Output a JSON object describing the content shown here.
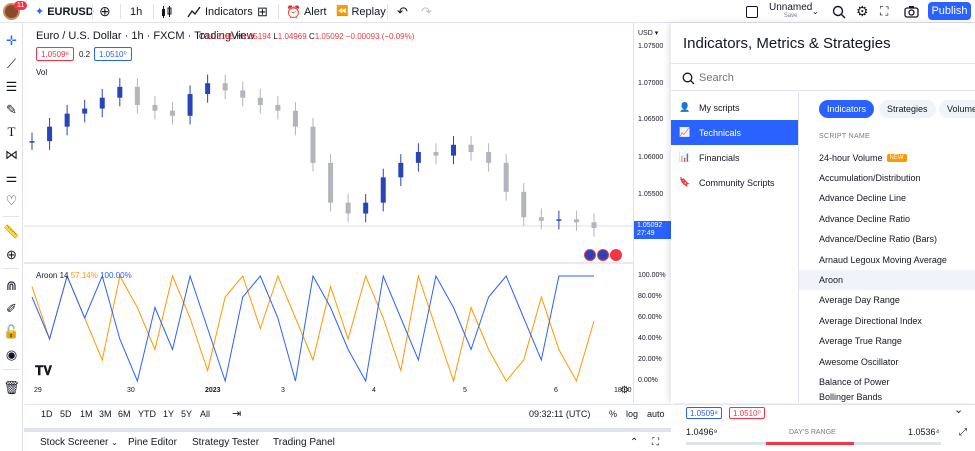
{
  "topbar": {
    "badge": "11",
    "symbol": "EURUSD",
    "interval": "1h",
    "indicators_label": "Indicators",
    "alert_label": "Alert",
    "replay_label": "Replay",
    "layout_name": "Unnamed",
    "save_label": "Save",
    "publish_label": "Publish"
  },
  "chart": {
    "title": "Euro / U.S. Dollar · 1h · FXCM · TradingView",
    "ohlc": {
      "o_label": "O",
      "o": "1.05185",
      "h_label": "H",
      "h": "1.05194",
      "l_label": "L",
      "l": "1.04969",
      "c_label": "C",
      "c": "1.05092",
      "chg": "−0.00093 (−0.09%)"
    },
    "sell_price": "1.0509⁸",
    "spread": "0.2",
    "buy_price": "1.0510⁰",
    "vol_label": "Vol",
    "aroon": {
      "name": "Aroon",
      "length": "14",
      "up": "57.14%",
      "down": "100.00%"
    },
    "currency": "USD",
    "price_ticks": [
      "1.07500",
      "1.07000",
      "1.06500",
      "1.06000",
      "1.05500",
      "1.05000"
    ],
    "current_price": "1.05092",
    "countdown": "27:49",
    "aroon_ticks": [
      "100.00%",
      "80.00%",
      "60.00%",
      "40.00%",
      "20.00%",
      "0.00%"
    ],
    "time_ticks": [
      "29",
      "30",
      "2023",
      "3",
      "4",
      "5",
      "6",
      "18:00"
    ]
  },
  "chart_data": {
    "type": "line",
    "title": "Euro / U.S. Dollar · 1h · FXCM · TradingView",
    "xlabel": "",
    "ylabel": "",
    "x_ticks": [
      "29",
      "30",
      "2023",
      "3",
      "4",
      "5",
      "6",
      "18:00"
    ],
    "ylim": [
      1.047,
      1.076
    ],
    "series": [
      {
        "name": "EURUSD close",
        "values": [
          1.063,
          1.065,
          1.0668,
          1.0675,
          1.069,
          1.0705,
          1.068,
          1.0672,
          1.0665,
          1.0695,
          1.071,
          1.07,
          1.069,
          1.068,
          1.0672,
          1.065,
          1.06,
          1.0545,
          1.053,
          1.0545,
          1.058,
          1.06,
          1.0615,
          1.061,
          1.0625,
          1.0615,
          1.06,
          1.056,
          1.0525,
          1.052,
          1.0522,
          1.0518,
          1.051
        ]
      },
      {
        "name": "Aroon Up",
        "values": [
          90,
          40,
          100,
          60,
          20,
          100,
          70,
          30,
          100,
          60,
          10,
          80,
          100,
          50,
          100,
          60,
          20,
          90,
          40,
          100,
          60,
          10,
          100,
          50,
          0,
          70,
          30,
          0,
          20,
          80,
          30,
          0,
          57.14
        ]
      },
      {
        "name": "Aroon Down",
        "values": [
          80,
          40,
          100,
          60,
          100,
          40,
          0,
          70,
          30,
          100,
          50,
          0,
          80,
          100,
          60,
          0,
          100,
          70,
          30,
          0,
          100,
          60,
          20,
          100,
          70,
          30,
          80,
          100,
          60,
          20,
          100,
          100,
          100
        ]
      }
    ]
  },
  "timeframes": [
    "1D",
    "5D",
    "1M",
    "3M",
    "6M",
    "YTD",
    "1Y",
    "5Y",
    "All"
  ],
  "clock": "09:32:11 (UTC)",
  "scale_opts": {
    "pct": "%",
    "log": "log",
    "auto": "auto"
  },
  "panels": [
    "Stock Screener",
    "Pine Editor",
    "Strategy Tester",
    "Trading Panel"
  ],
  "indicators_panel": {
    "title": "Indicators, Metrics & Strategies",
    "search_placeholder": "Search",
    "categories": [
      "My scripts",
      "Technicals",
      "Financials",
      "Community Scripts"
    ],
    "tabs": [
      "Indicators",
      "Strategies",
      "Volume"
    ],
    "column_header": "SCRIPT NAME",
    "scripts": [
      "24-hour Volume",
      "Accumulation/Distribution",
      "Advance Decline Line",
      "Advance Decline Ratio",
      "Advance/Decline Ratio (Bars)",
      "Arnaud Legoux Moving Average",
      "Aroon",
      "Average Day Range",
      "Average Directional Index",
      "Average True Range",
      "Awesome Oscillator",
      "Balance of Power",
      "Bollinger Bands"
    ],
    "new_badge": "NEW"
  },
  "widget": {
    "sell": "1.0509⁸",
    "buy": "1.0510⁰",
    "low": "1.0496⁹",
    "range_label": "DAY'S RANGE",
    "high": "1.0536⁴"
  },
  "colors": {
    "accent": "#2962ff",
    "up_candle": "#2a44b8",
    "down_candle": "#b2b5be",
    "aroon_up": "#ff9800",
    "aroon_down": "#2962ff",
    "sell": "#f23645"
  }
}
